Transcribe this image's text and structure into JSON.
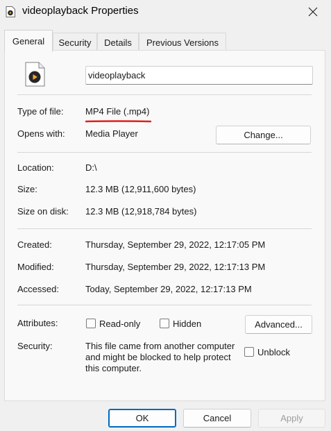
{
  "window": {
    "title": "videoplayback Properties",
    "close_icon": "close-icon",
    "file_icon": "mp4-file-icon"
  },
  "tabs": [
    {
      "label": "General",
      "active": true
    },
    {
      "label": "Security",
      "active": false
    },
    {
      "label": "Details",
      "active": false
    },
    {
      "label": "Previous Versions",
      "active": false
    }
  ],
  "general": {
    "file_name": "videoplayback",
    "type_label": "Type of file:",
    "type_value": "MP4 File (.mp4)",
    "opens_label": "Opens with:",
    "opens_value": "Media Player",
    "change_button": "Change...",
    "location_label": "Location:",
    "location_value": "D:\\",
    "size_label": "Size:",
    "size_value": "12.3 MB (12,911,600 bytes)",
    "disk_label": "Size on disk:",
    "disk_value": "12.3 MB (12,918,784 bytes)",
    "created_label": "Created:",
    "created_value": "Thursday, September 29, 2022, 12:17:05 PM",
    "modified_label": "Modified:",
    "modified_value": "Thursday, September 29, 2022, 12:17:13 PM",
    "accessed_label": "Accessed:",
    "accessed_value": "Today, September 29, 2022, 12:17:13 PM",
    "attributes_label": "Attributes:",
    "readonly_label": "Read-only",
    "readonly_checked": false,
    "hidden_label": "Hidden",
    "hidden_checked": false,
    "advanced_button": "Advanced...",
    "security_label": "Security:",
    "security_line1": "This file came from another computer",
    "security_line2": "and might be blocked to help protect",
    "security_line3": "this computer.",
    "unblock_label": "Unblock",
    "unblock_checked": false
  },
  "footer": {
    "ok": "OK",
    "cancel": "Cancel",
    "apply": "Apply"
  },
  "colors": {
    "annotation_underline": "#e0201b",
    "accent": "#0067c0"
  }
}
